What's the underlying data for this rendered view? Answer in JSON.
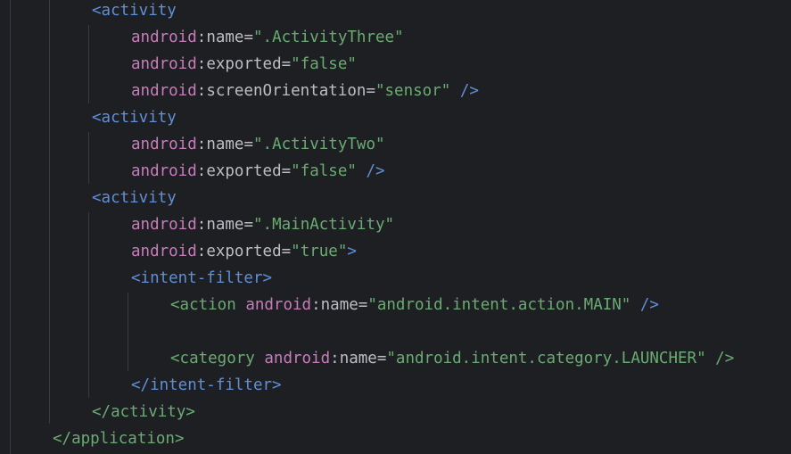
{
  "editor": {
    "background": "#1e1f22",
    "colors": {
      "tag": "#5f8fd6",
      "namespace": "#c77dbb",
      "attribute": "#bcbec4",
      "string": "#6aab73",
      "guide": "#393b40"
    },
    "lines": [
      {
        "indent": 1,
        "tokens": [
          {
            "t": "<activity",
            "c": "tag"
          }
        ]
      },
      {
        "indent": 2,
        "tokens": [
          {
            "t": "android",
            "c": "attr-ns"
          },
          {
            "t": ":",
            "c": "colon"
          },
          {
            "t": "name",
            "c": "attr-name"
          },
          {
            "t": "=",
            "c": "eq"
          },
          {
            "t": "\".ActivityThree\"",
            "c": "str"
          }
        ]
      },
      {
        "indent": 2,
        "tokens": [
          {
            "t": "android",
            "c": "attr-ns"
          },
          {
            "t": ":",
            "c": "colon"
          },
          {
            "t": "exported",
            "c": "attr-name"
          },
          {
            "t": "=",
            "c": "eq"
          },
          {
            "t": "\"false\"",
            "c": "str"
          }
        ]
      },
      {
        "indent": 2,
        "tokens": [
          {
            "t": "android",
            "c": "attr-ns"
          },
          {
            "t": ":",
            "c": "colon"
          },
          {
            "t": "screenOrientation",
            "c": "attr-name"
          },
          {
            "t": "=",
            "c": "eq"
          },
          {
            "t": "\"sensor\"",
            "c": "str"
          },
          {
            "t": " />",
            "c": "tag"
          }
        ]
      },
      {
        "indent": 1,
        "tokens": [
          {
            "t": "<activity",
            "c": "tag"
          }
        ]
      },
      {
        "indent": 2,
        "tokens": [
          {
            "t": "android",
            "c": "attr-ns"
          },
          {
            "t": ":",
            "c": "colon"
          },
          {
            "t": "name",
            "c": "attr-name"
          },
          {
            "t": "=",
            "c": "eq"
          },
          {
            "t": "\".ActivityTwo\"",
            "c": "str"
          }
        ]
      },
      {
        "indent": 2,
        "tokens": [
          {
            "t": "android",
            "c": "attr-ns"
          },
          {
            "t": ":",
            "c": "colon"
          },
          {
            "t": "exported",
            "c": "attr-name"
          },
          {
            "t": "=",
            "c": "eq"
          },
          {
            "t": "\"false\"",
            "c": "str"
          },
          {
            "t": " />",
            "c": "tag"
          }
        ]
      },
      {
        "indent": 1,
        "tokens": [
          {
            "t": "<activity",
            "c": "tag"
          }
        ]
      },
      {
        "indent": 2,
        "tokens": [
          {
            "t": "android",
            "c": "attr-ns"
          },
          {
            "t": ":",
            "c": "colon"
          },
          {
            "t": "name",
            "c": "attr-name"
          },
          {
            "t": "=",
            "c": "eq"
          },
          {
            "t": "\".MainActivity\"",
            "c": "str"
          }
        ]
      },
      {
        "indent": 2,
        "tokens": [
          {
            "t": "android",
            "c": "attr-ns"
          },
          {
            "t": ":",
            "c": "colon"
          },
          {
            "t": "exported",
            "c": "attr-name"
          },
          {
            "t": "=",
            "c": "eq"
          },
          {
            "t": "\"true\"",
            "c": "str"
          },
          {
            "t": ">",
            "c": "tag"
          }
        ]
      },
      {
        "indent": 2,
        "tokens": [
          {
            "t": "<intent-filter>",
            "c": "tag"
          }
        ]
      },
      {
        "indent": 3,
        "tokens": [
          {
            "t": "<action",
            "c": "green-tag"
          },
          {
            "t": " ",
            "c": "colon"
          },
          {
            "t": "android",
            "c": "attr-ns"
          },
          {
            "t": ":",
            "c": "colon"
          },
          {
            "t": "name",
            "c": "attr-name"
          },
          {
            "t": "=",
            "c": "eq"
          },
          {
            "t": "\"android.intent.action.MAIN\"",
            "c": "str"
          },
          {
            "t": " />",
            "c": "tag"
          }
        ]
      },
      {
        "indent": 3,
        "tokens": []
      },
      {
        "indent": 3,
        "tokens": [
          {
            "t": "<category",
            "c": "green-tag"
          },
          {
            "t": " ",
            "c": "colon"
          },
          {
            "t": "android",
            "c": "attr-ns"
          },
          {
            "t": ":",
            "c": "colon"
          },
          {
            "t": "name",
            "c": "attr-name"
          },
          {
            "t": "=",
            "c": "eq"
          },
          {
            "t": "\"android.intent.category.LAUNCHER\"",
            "c": "str"
          },
          {
            "t": " />",
            "c": "green-tag"
          }
        ]
      },
      {
        "indent": 2,
        "tokens": [
          {
            "t": "</intent-filter>",
            "c": "tag"
          }
        ]
      },
      {
        "indent": 1,
        "tokens": [
          {
            "t": "</activity>",
            "c": "green-tag"
          }
        ]
      },
      {
        "indent": 0,
        "tokens": [
          {
            "t": "</application>",
            "c": "green-tag"
          }
        ]
      }
    ]
  }
}
